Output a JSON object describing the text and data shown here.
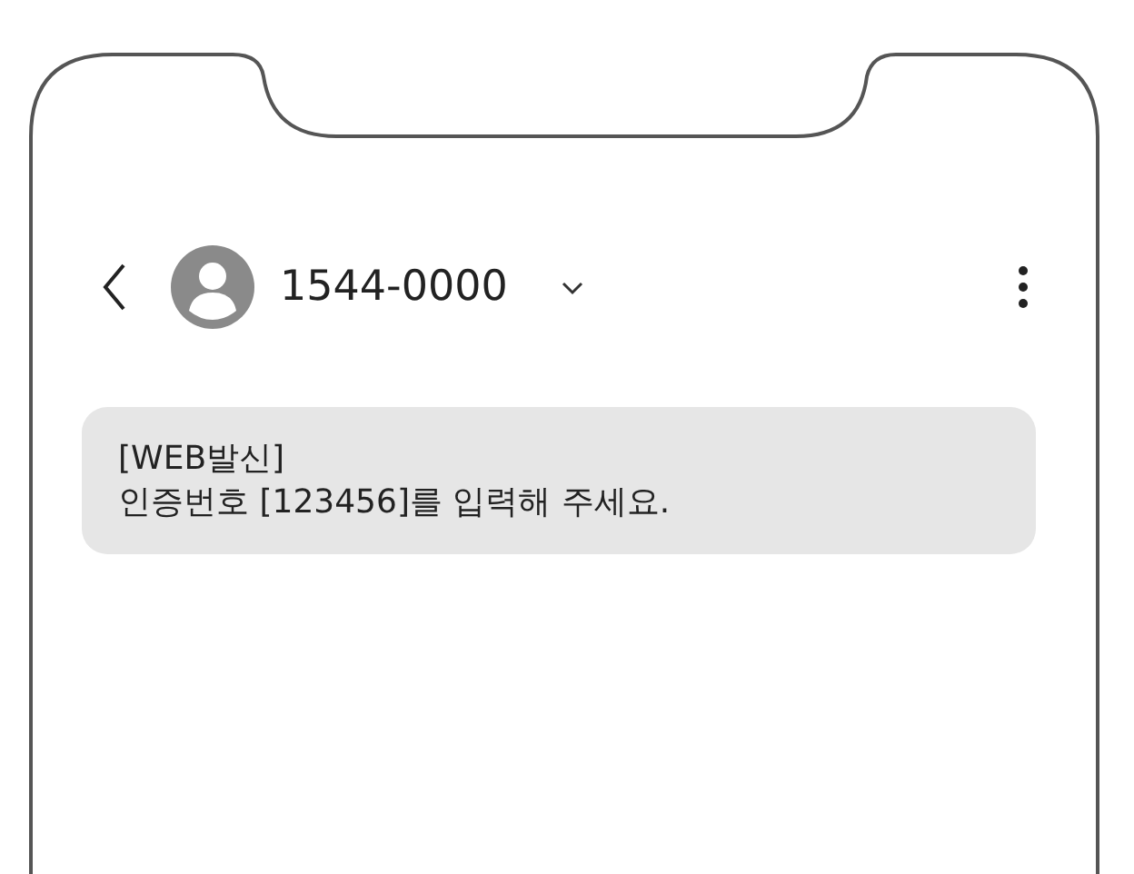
{
  "header": {
    "contact": "1544-0000"
  },
  "messages": [
    {
      "text": "[WEB발신]\n인증번호 [123456]를 입력해 주세요."
    }
  ]
}
